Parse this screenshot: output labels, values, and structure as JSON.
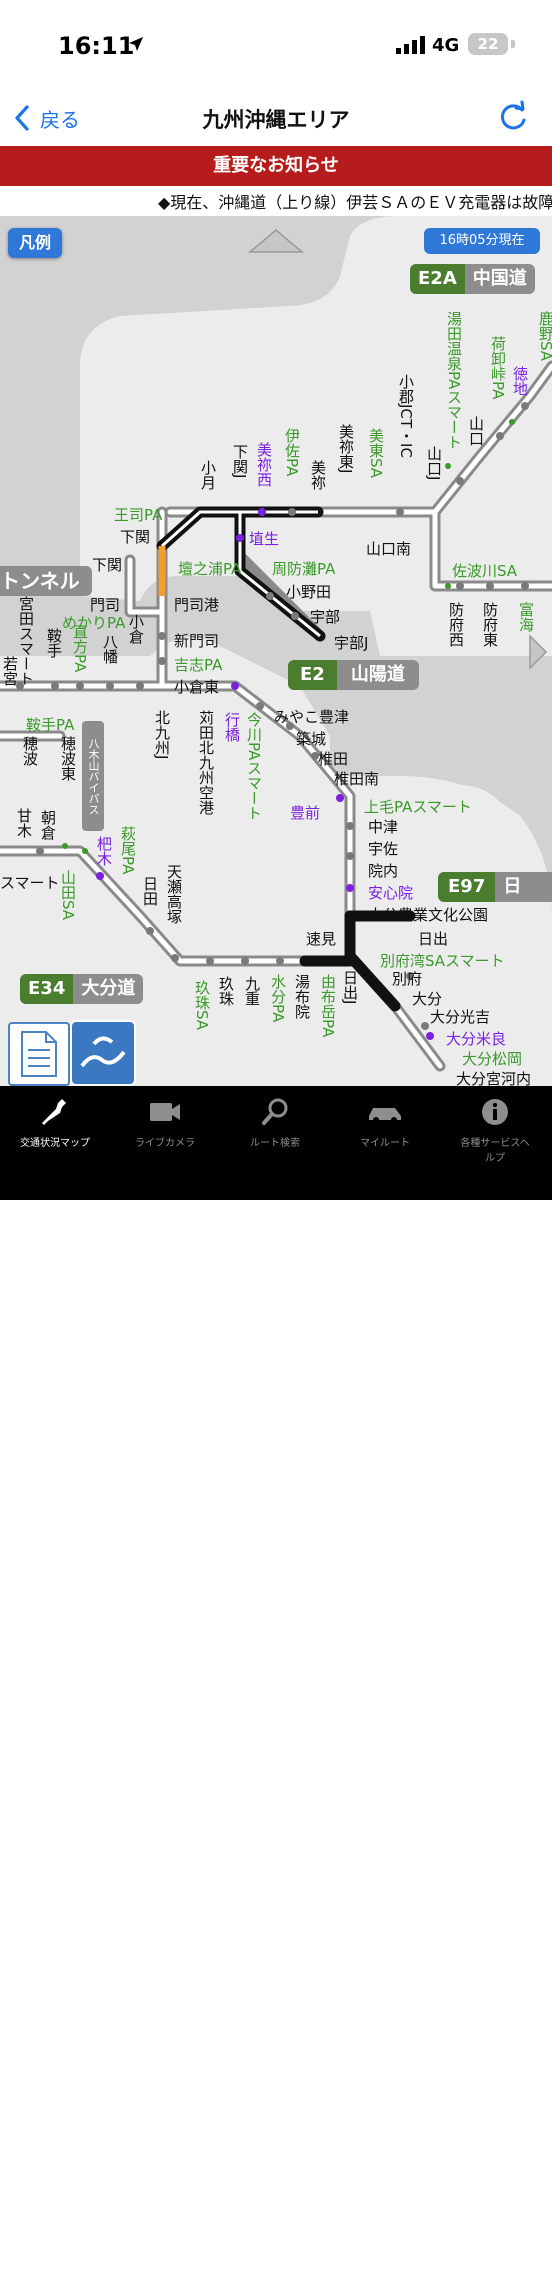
{
  "status_bar": {
    "time": "16:11",
    "network": "4G",
    "battery": "22"
  },
  "nav": {
    "back_label": "戻る",
    "title": "九州沖縄エリア"
  },
  "notice": {
    "label": "重要なお知らせ",
    "ticker": "◆現在、沖縄道（上り線）伊芸ＳＡのＥＶ充電器は故障のた"
  },
  "map": {
    "legend_button": "凡例",
    "timestamp": "16時05分現在",
    "route_badges": [
      {
        "code": "E2A",
        "name": "中国道"
      },
      {
        "code": "E2",
        "name": "山陽道"
      },
      {
        "code": "E97",
        "name": "日出"
      },
      {
        "code": "E34",
        "name": "大分道"
      }
    ],
    "tunnel_label": "トンネル",
    "bypass_label": "八木山バイパス",
    "labels": {
      "yudaonsen": "湯田温泉PAスマート",
      "shikano": "鹿野SA",
      "nishiki": "荷卸峠PA",
      "tokuji": "徳地",
      "yamaguchi_jct": "小郡JCT・IC",
      "yamaguchi_j": "山口J",
      "yamaguchi": "山口",
      "mito_higashi_sa": "美東SA",
      "mine_higashi_j": "美祢東J",
      "mine": "美祢",
      "isa_pa": "伊佐PA",
      "mine_nishi": "美祢西",
      "shimonoseki_j": "下関J",
      "ozuki": "小月",
      "ojipa": "王司PA",
      "shimonoseki": "下関",
      "hanyu": "埴生",
      "yamaguchiminami": "山口南",
      "sabagawa_sa": "佐波川SA",
      "suo_nada_pa": "周防灘PA",
      "onoda": "小野田",
      "ube": "宇部",
      "ube_j": "宇部J",
      "hofu_nishi": "防府西",
      "hofu_higashi": "防府東",
      "tominomi": "富海",
      "dannoura_pa": "壇之浦PA",
      "moji_port": "門司港",
      "shinmoji": "新門司",
      "kishi_pa": "吉志PA",
      "kokura_higashi": "小倉東",
      "moji": "門司",
      "mekari_pa": "めかりPA",
      "shimonoseki_w": "下関",
      "kokura": "小倉",
      "yahata": "八幡",
      "kurate": "鞍手",
      "naokata_pa": "直方PA",
      "miyata": "宮田スマート",
      "wakamiya": "若宮",
      "kitakyushu_j": "北九州J",
      "kitakyushu_airport": "苅田北九州空港",
      "yukuhashi": "行橋",
      "imagawa": "今川PAスマート",
      "miyakotoyotsu": "みやこ豊津",
      "chikujo": "築城",
      "shiida": "椎田",
      "shiida_minami": "椎田南",
      "buzen": "豊前",
      "kozuke_pa": "上毛PAスマート",
      "nakatsu": "中津",
      "usa": "宇佐",
      "innai": "院内",
      "anshinin": "安心院",
      "oita_nogyo": "大分農業文化公園",
      "hiji": "日出",
      "hayami": "速見",
      "hiji_j": "日出J",
      "beppuwan": "別府湾SAスマート",
      "beppu": "別府",
      "oita": "大分",
      "oita_mitsuyoshi": "大分光吉",
      "oita_mera": "大分米良",
      "oita_matsuoka": "大分松岡",
      "oita_miyagawachi": "大分宮河内",
      "kurate_pa": "鞍手PA",
      "honami": "穂波",
      "honami_higashi": "穂波東",
      "amagi": "甘木",
      "asakura": "朝倉",
      "hagio_pa": "萩尾PA",
      "kitsuki": "杷木",
      "yamada_sa": "山田SA",
      "hita": "日田",
      "amagase": "天瀬高塚",
      "kusu": "玖珠",
      "kokonoe": "九重",
      "yufuin": "湯布院",
      "yufudake_pa": "由布岳PA",
      "mizuwake_pa": "水分PA",
      "kusu_sa": "玖珠SA",
      "smart_w": "スマート",
      "yufu": "湯布院"
    }
  },
  "tabs": [
    {
      "label": "交通状況マップ",
      "icon": "japan-map-icon"
    },
    {
      "label": "ライブカメラ",
      "icon": "camera-icon"
    },
    {
      "label": "ルート検索",
      "icon": "magnifier-icon"
    },
    {
      "label": "マイルート",
      "icon": "car-icon"
    },
    {
      "label": "各種サービスヘルプ",
      "icon": "info-icon"
    }
  ],
  "colors": {
    "accent": "#1a73e8",
    "notice": "#b71c1c",
    "route_badge": "#4b7d2e",
    "congestion": "#f0a030",
    "ic_label": "#3a9a2a",
    "sa_label": "#3a9a2a",
    "junction_purple": "#7a22e0"
  }
}
